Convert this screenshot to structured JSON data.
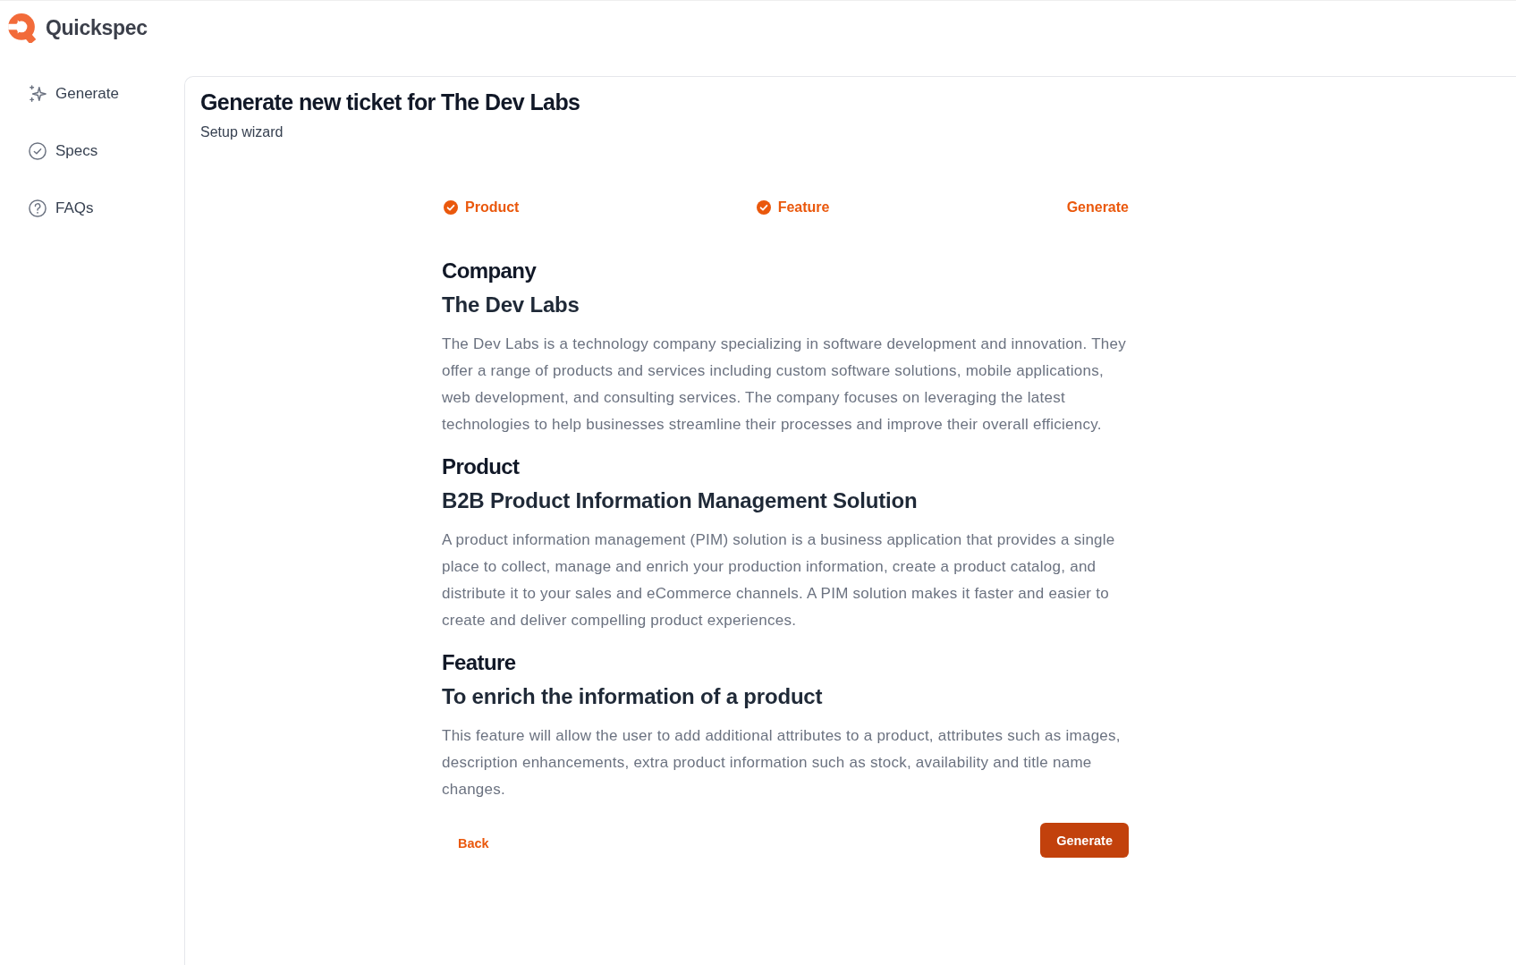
{
  "app": {
    "name": "Quickspec"
  },
  "sidebar": {
    "items": [
      {
        "label": "Generate"
      },
      {
        "label": "Specs"
      },
      {
        "label": "FAQs"
      }
    ]
  },
  "page": {
    "title": "Generate new ticket for The Dev Labs",
    "subtitle": "Setup wizard"
  },
  "stepper": {
    "steps": [
      {
        "label": "Product",
        "completed": true
      },
      {
        "label": "Feature",
        "completed": true
      },
      {
        "label": "Generate",
        "completed": false
      }
    ]
  },
  "sections": [
    {
      "heading": "Company",
      "name": "The Dev Labs",
      "description": "The Dev Labs is a technology company specializing in software development and innovation. They offer a range of products and services including custom software solutions, mobile applications, web development, and consulting services. The company focuses on leveraging the latest technologies to help businesses streamline their processes and improve their overall efficiency."
    },
    {
      "heading": "Product",
      "name": "B2B Product Information Management Solution",
      "description": "A product information management (PIM) solution is a business application that provides a single place to collect, manage and enrich your production information, create a product catalog, and distribute it to your sales and eCommerce channels. A PIM solution makes it faster and easier to create and deliver compelling product experiences."
    },
    {
      "heading": "Feature",
      "name": "To enrich the information of a product",
      "description": "This feature will allow the user to add additional attributes to a product, attributes such as images, description enhancements, extra product information such as stock, availability and title name changes."
    }
  ],
  "actions": {
    "back": "Back",
    "primary": "Generate"
  }
}
